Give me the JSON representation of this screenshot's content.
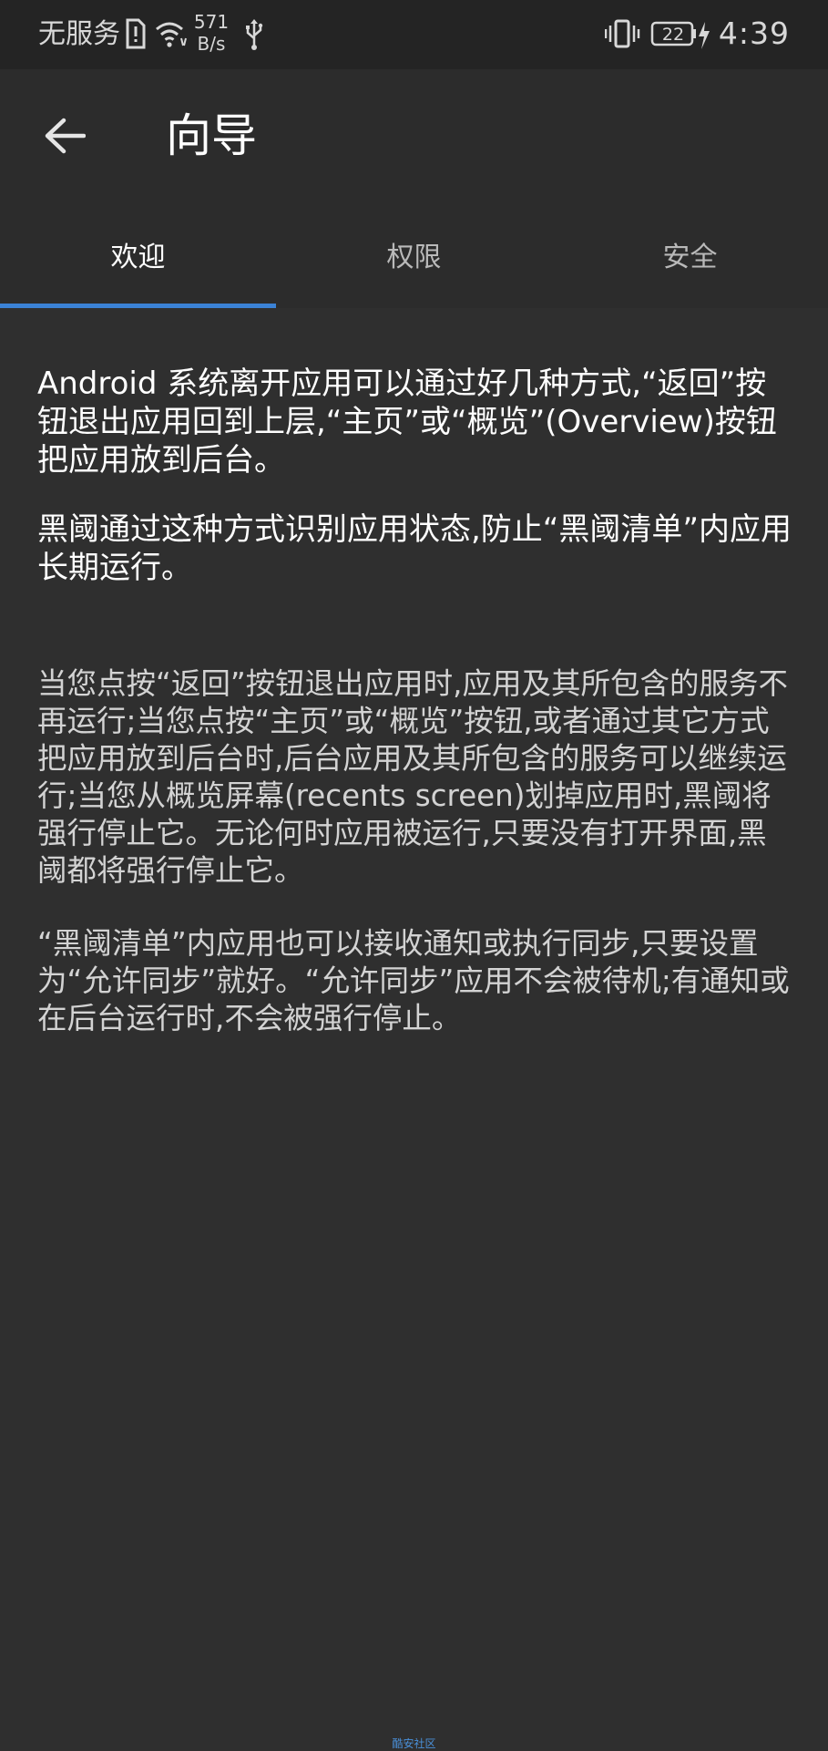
{
  "status_bar": {
    "carrier": "无服务",
    "speed_value": "571",
    "speed_unit": "B/s",
    "battery": "22",
    "time": "4:39"
  },
  "app_bar": {
    "title": "向导"
  },
  "tabs": [
    {
      "label": "欢迎",
      "active": true
    },
    {
      "label": "权限",
      "active": false
    },
    {
      "label": "安全",
      "active": false
    }
  ],
  "colors": {
    "accent": "#3b82d6",
    "background": "#2f2f2f",
    "bar": "#2c2c2c"
  },
  "content": {
    "paragraph_1": "Android 系统离开应用可以通过好几种方式,“返回”按钮退出应用回到上层,“主页”或“概览”(Overview)按钮把应用放到后台。",
    "paragraph_2": "黑阈通过这种方式识别应用状态,防止“黑阈清单”内应用长期运行。",
    "paragraph_3": "当您点按“返回”按钮退出应用时,应用及其所包含的服务不再运行;当您点按“主页”或“概览”按钮,或者通过其它方式把应用放到后台时,后台应用及其所包含的服务可以继续运行;当您从概览屏幕(recents screen)划掉应用时,黑阈将强行停止它。无论何时应用被运行,只要没有打开界面,黑阈都将强行停止它。",
    "paragraph_4": "“黑阈清单”内应用也可以接收通知或执行同步,只要设置为“允许同步”就好。“允许同步”应用不会被待机;有通知或在后台运行时,不会被强行停止。"
  },
  "watermark": "酷安社区"
}
